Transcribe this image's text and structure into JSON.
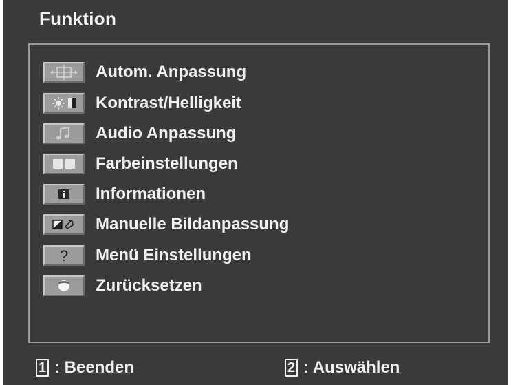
{
  "osd": {
    "title": "Funktion",
    "menu_items": [
      {
        "label": "Autom. Anpassung",
        "icon": "auto-adjust-icon"
      },
      {
        "label": "Kontrast/Helligkeit",
        "icon": "contrast-brightness-icon"
      },
      {
        "label": "Audio Anpassung",
        "icon": "audio-note-icon"
      },
      {
        "label": "Farbeinstellungen",
        "icon": "color-blocks-icon"
      },
      {
        "label": "Informationen",
        "icon": "info-icon"
      },
      {
        "label": "Manuelle Bildanpassung",
        "icon": "manual-image-adjust-icon"
      },
      {
        "label": "Menü Einstellungen",
        "icon": "question-mark-icon"
      },
      {
        "label": "Zurücksetzen",
        "icon": "reset-icon"
      }
    ],
    "footer": {
      "exit_key": "1",
      "exit_label": ": Beenden",
      "select_key": "2",
      "select_label": ": Auswählen"
    }
  },
  "colors": {
    "background": "#3a3a3a",
    "text": "#f0f0f0",
    "icon_face": "#9c9c9c",
    "border": "#9a9a9a"
  }
}
